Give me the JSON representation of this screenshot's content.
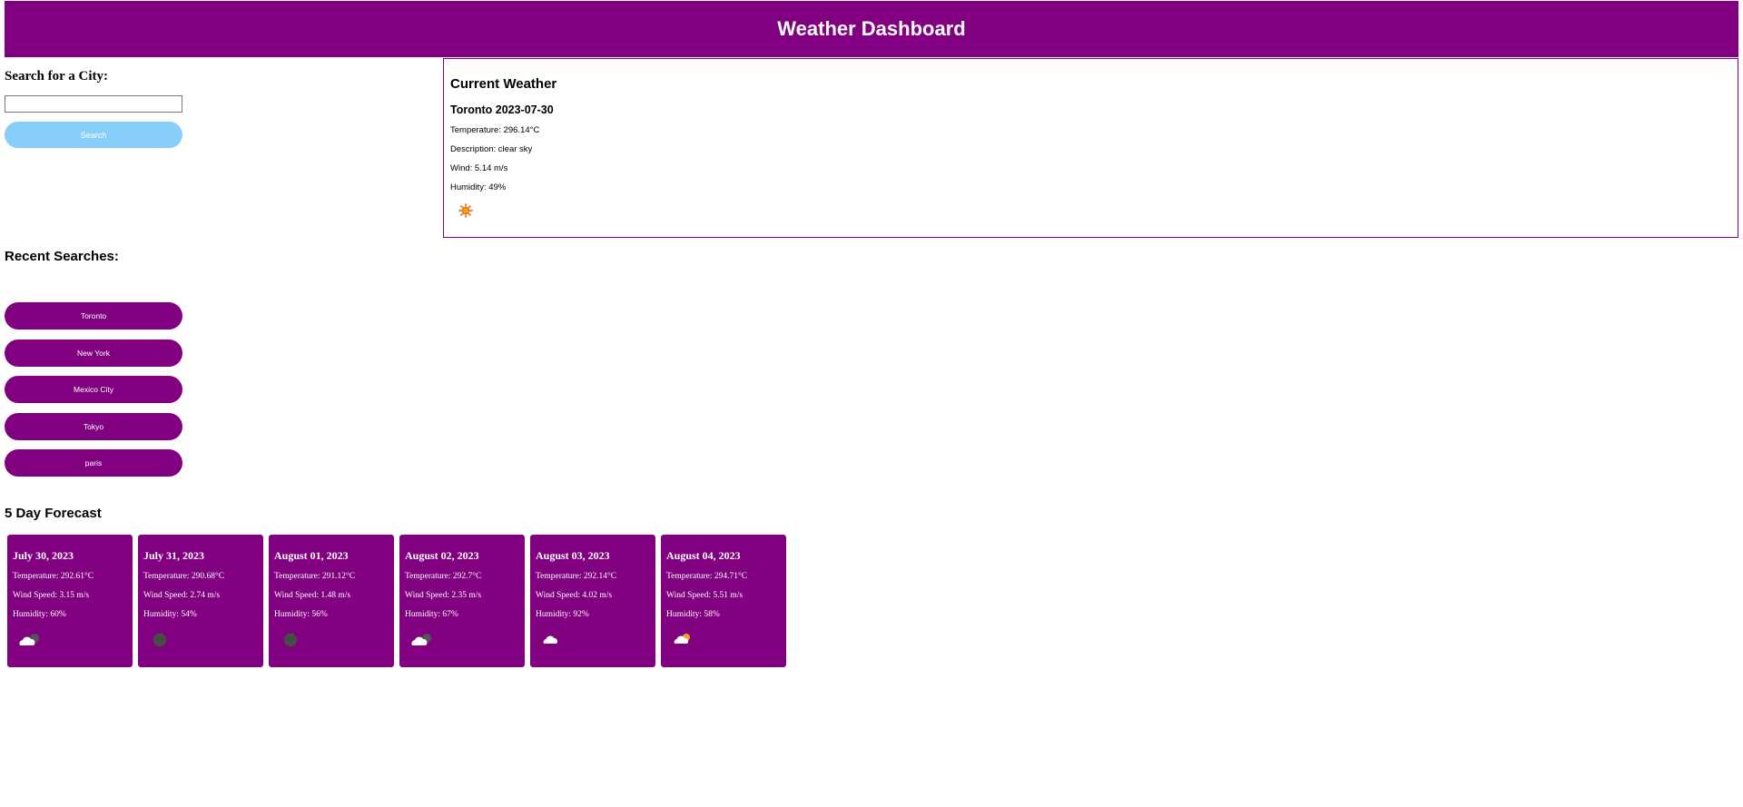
{
  "header": {
    "title": "Weather Dashboard"
  },
  "search": {
    "title": "Search for a City:",
    "input_value": "",
    "button_label": "Search"
  },
  "current": {
    "heading": "Current Weather",
    "city_date": "Toronto 2023-07-30",
    "temperature": "Temperature: 296.14°C",
    "description": "Description: clear sky",
    "wind": "Wind: 5.14 m/s",
    "humidity": "Humidity: 49%",
    "icon": "sun-icon"
  },
  "recent": {
    "title": "Recent Searches:",
    "items": [
      "Toronto",
      "New York",
      "Mexico City",
      "Tokyo",
      "paris"
    ]
  },
  "forecast": {
    "title": "5 Day Forecast",
    "days": [
      {
        "date": "July 30, 2023",
        "temp": "Temperature: 292.61°C",
        "wind": "Wind Speed: 3.15 m/s",
        "humidity": "Humidity: 60%",
        "icon": "cloudy-night-icon"
      },
      {
        "date": "July 31, 2023",
        "temp": "Temperature: 290.68°C",
        "wind": "Wind Speed: 2.74 m/s",
        "humidity": "Humidity: 54%",
        "icon": "moon-icon"
      },
      {
        "date": "August 01, 2023",
        "temp": "Temperature: 291.12°C",
        "wind": "Wind Speed: 1.48 m/s",
        "humidity": "Humidity: 56%",
        "icon": "moon-icon"
      },
      {
        "date": "August 02, 2023",
        "temp": "Temperature: 292.7°C",
        "wind": "Wind Speed: 2.35 m/s",
        "humidity": "Humidity: 67%",
        "icon": "cloudy-night-icon"
      },
      {
        "date": "August 03, 2023",
        "temp": "Temperature: 292.14°C",
        "wind": "Wind Speed: 4.02 m/s",
        "humidity": "Humidity: 92%",
        "icon": "cloud-icon"
      },
      {
        "date": "August 04, 2023",
        "temp": "Temperature: 294.71°C",
        "wind": "Wind Speed: 5.51 m/s",
        "humidity": "Humidity: 58%",
        "icon": "partly-cloudy-icon"
      }
    ]
  },
  "colors": {
    "primary": "#800080",
    "search_button": "#87cefa"
  }
}
